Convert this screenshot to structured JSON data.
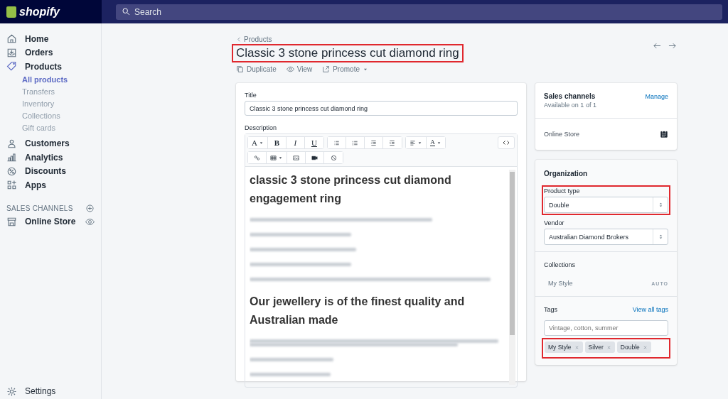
{
  "topbar": {
    "logo": "shopify",
    "search": {
      "placeholder": "Search"
    }
  },
  "sidebar": {
    "items": [
      {
        "label": "Home",
        "selected": false
      },
      {
        "label": "Orders",
        "selected": false
      },
      {
        "label": "Products",
        "selected": true,
        "children": [
          {
            "label": "All products",
            "selected": true
          },
          {
            "label": "Transfers",
            "selected": false
          },
          {
            "label": "Inventory",
            "selected": false
          },
          {
            "label": "Collections",
            "selected": false
          },
          {
            "label": "Gift cards",
            "selected": false
          }
        ]
      },
      {
        "label": "Customers",
        "selected": false
      },
      {
        "label": "Analytics",
        "selected": false
      },
      {
        "label": "Discounts",
        "selected": false
      },
      {
        "label": "Apps",
        "selected": false
      }
    ],
    "sales_channels": {
      "heading": "SALES CHANNELS",
      "items": [
        {
          "label": "Online Store"
        }
      ]
    },
    "settings": "Settings"
  },
  "page": {
    "back": "Products",
    "title": "Classic 3 stone princess cut diamond ring",
    "title_highlighted": true,
    "actions": [
      {
        "label": "Duplicate",
        "dropdown": false
      },
      {
        "label": "View",
        "dropdown": false
      },
      {
        "label": "Promote",
        "dropdown": true
      }
    ]
  },
  "product_card": {
    "title_label": "Title",
    "title_value": "Classic 3 stone princess cut diamond ring",
    "description_label": "Description",
    "toolbar": [
      [
        {
          "kind": "font",
          "text": "A",
          "dropdown": true
        },
        {
          "kind": "bold",
          "text": "B",
          "dropdown": false
        },
        {
          "kind": "italic",
          "text": "I",
          "dropdown": false
        },
        {
          "kind": "underline",
          "text": "U",
          "dropdown": false
        }
      ],
      [
        {
          "kind": "bullets",
          "dropdown": false
        },
        {
          "kind": "numbers",
          "dropdown": false
        },
        {
          "kind": "outdent",
          "dropdown": false
        },
        {
          "kind": "indent",
          "dropdown": false
        }
      ],
      [
        {
          "kind": "align",
          "dropdown": true
        },
        {
          "kind": "color",
          "text": "A",
          "dropdown": true
        }
      ],
      [
        {
          "kind": "link",
          "dropdown": false
        },
        {
          "kind": "table",
          "dropdown": true
        },
        {
          "kind": "image",
          "dropdown": false
        },
        {
          "kind": "video",
          "dropdown": false
        },
        {
          "kind": "clear",
          "dropdown": false
        }
      ]
    ],
    "content": [
      {
        "kind": "heading",
        "text": "classic 3 stone princess cut diamond engagement ring"
      },
      {
        "kind": "redacted"
      },
      {
        "kind": "redacted"
      },
      {
        "kind": "redacted"
      },
      {
        "kind": "redacted"
      },
      {
        "kind": "redacted"
      },
      {
        "kind": "heading",
        "text": "Our jewellery is of the finest quality and Australian made"
      },
      {
        "kind": "redacted-wrap"
      },
      {
        "kind": "redacted"
      },
      {
        "kind": "redacted"
      }
    ]
  },
  "sales_channels": {
    "title": "Sales channels",
    "subtitle": "Available on 1 of 1",
    "action": "Manage",
    "channels": [
      {
        "name": "Online Store"
      }
    ]
  },
  "organization": {
    "title": "Organization",
    "product_type": {
      "label": "Product type",
      "value": "Double",
      "highlighted": true
    },
    "vendor": {
      "label": "Vendor",
      "value": "Australian Diamond Brokers"
    },
    "collections": {
      "label": "Collections",
      "items": [
        {
          "name": "My Style",
          "badge": "AUTO"
        }
      ]
    },
    "tags": {
      "label": "Tags",
      "link": "View all tags",
      "placeholder": "Vintage, cotton, summer",
      "highlighted": true,
      "items": [
        "My Style",
        "Silver",
        "Double"
      ]
    }
  }
}
